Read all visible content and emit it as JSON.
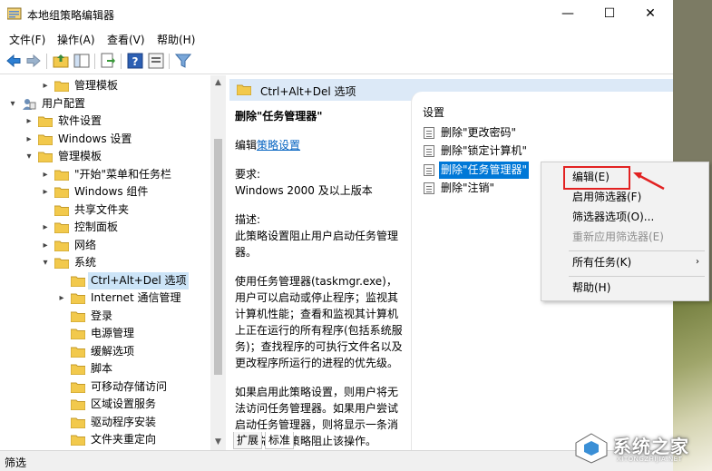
{
  "window": {
    "title": "本地组策略编辑器",
    "minimize": "—",
    "maximize": "☐",
    "close": "✕"
  },
  "menu": [
    "文件(F)",
    "操作(A)",
    "查看(V)",
    "帮助(H)"
  ],
  "toolbar": {
    "icons": [
      "back-icon",
      "forward-icon",
      "up-folder-icon",
      "show-hide-tree-icon",
      "export-list-icon",
      "help-icon",
      "properties-icon",
      "filter-icon"
    ]
  },
  "tree": {
    "items": [
      {
        "label": "管理模板",
        "level": 2,
        "expander": "▸"
      },
      {
        "label": "用户配置",
        "level": 0,
        "expander": "▾",
        "icon": "user-config-icon"
      },
      {
        "label": "软件设置",
        "level": 1,
        "expander": "▸"
      },
      {
        "label": "Windows 设置",
        "level": 1,
        "expander": "▸"
      },
      {
        "label": "管理模板",
        "level": 1,
        "expander": "▾"
      },
      {
        "label": "\"开始\"菜单和任务栏",
        "level": 2,
        "expander": "▸"
      },
      {
        "label": "Windows 组件",
        "level": 2,
        "expander": "▸"
      },
      {
        "label": "共享文件夹",
        "level": 2,
        "expander": ""
      },
      {
        "label": "控制面板",
        "level": 2,
        "expander": "▸"
      },
      {
        "label": "网络",
        "level": 2,
        "expander": "▸"
      },
      {
        "label": "系统",
        "level": 2,
        "expander": "▾"
      },
      {
        "label": "Ctrl+Alt+Del 选项",
        "level": 3,
        "expander": "",
        "selected": true
      },
      {
        "label": "Internet 通信管理",
        "level": 3,
        "expander": "▸"
      },
      {
        "label": "登录",
        "level": 3,
        "expander": ""
      },
      {
        "label": "电源管理",
        "level": 3,
        "expander": ""
      },
      {
        "label": "缓解选项",
        "level": 3,
        "expander": ""
      },
      {
        "label": "脚本",
        "level": 3,
        "expander": ""
      },
      {
        "label": "可移动存储访问",
        "level": 3,
        "expander": ""
      },
      {
        "label": "区域设置服务",
        "level": 3,
        "expander": ""
      },
      {
        "label": "驱动程序安装",
        "level": 3,
        "expander": ""
      },
      {
        "label": "文件夹重定向",
        "level": 3,
        "expander": ""
      }
    ]
  },
  "header": {
    "title": "Ctrl+Alt+Del 选项"
  },
  "description": {
    "policy_title": "删除\"任务管理器\"",
    "edit_prefix": "编辑",
    "edit_link": "策略设置",
    "requirement_label": "要求:",
    "requirement_value": "Windows 2000 及以上版本",
    "desc_label": "描述:",
    "desc_text": "此策略设置阻止用户启动任务管理器。",
    "desc_text2": "使用任务管理器(taskmgr.exe)，用户可以启动或停止程序；监视其计算机性能；查看和监视其计算机上正在运行的所有程序(包括系统服务)；查找程序的可执行文件名以及更改程序所运行的进程的优先级。",
    "desc_text3": "如果启用此策略设置，则用户将无法访问任务管理器。如果用户尝试启动任务管理器，则将显示一条消息，说明某策略阻止该操作。"
  },
  "settings": {
    "header": "设置",
    "items": [
      {
        "label": "删除\"更改密码\""
      },
      {
        "label": "删除\"锁定计算机\""
      },
      {
        "label": "删除\"任务管理器\"",
        "highlighted": true
      },
      {
        "label": "删除\"注销\""
      }
    ]
  },
  "tabs": [
    "扩展",
    "标准"
  ],
  "status": "筛选",
  "context_menu": {
    "items": [
      {
        "label": "编辑(E)"
      },
      {
        "label": "启用筛选器(F)"
      },
      {
        "label": "筛选器选项(O)..."
      },
      {
        "label": "重新应用筛选器(E)",
        "disabled": true
      },
      {
        "label": "所有任务(K)",
        "submenu": "›"
      },
      {
        "label": "帮助(H)"
      }
    ]
  },
  "watermark": {
    "text": "系统之家",
    "sub": "XITONGZHIJIA.NET"
  },
  "colors": {
    "selection": "#0078d7",
    "tree_selection": "#cce4f7",
    "header_bg": "#dce9f7",
    "annotation": "#e22222"
  }
}
